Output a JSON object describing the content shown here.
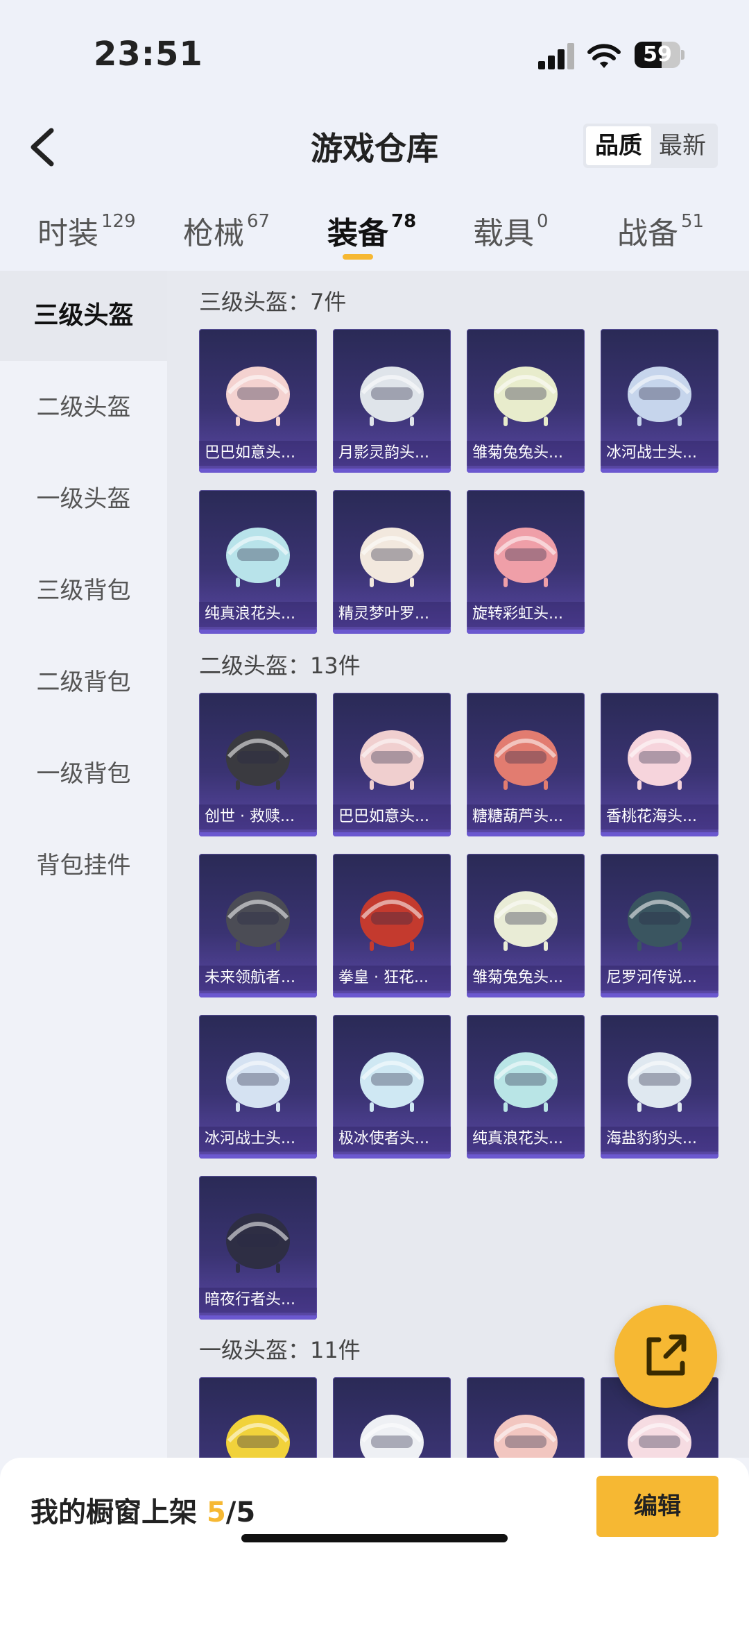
{
  "status": {
    "time": "23:51",
    "battery": "59",
    "battery_level": 0.59
  },
  "header": {
    "title": "游戏仓库",
    "sort_options": [
      "品质",
      "最新"
    ]
  },
  "tabs": [
    {
      "label": "时装",
      "count": "129"
    },
    {
      "label": "枪械",
      "count": "67"
    },
    {
      "label": "装备",
      "count": "78"
    },
    {
      "label": "载具",
      "count": "0"
    },
    {
      "label": "战备",
      "count": "51"
    }
  ],
  "sidebar": {
    "items": [
      "三级头盔",
      "二级头盔",
      "一级头盔",
      "三级背包",
      "二级背包",
      "一级背包",
      "背包挂件"
    ]
  },
  "sections": [
    {
      "title": "三级头盔：7件",
      "items": [
        {
          "name": "巴巴如意头...",
          "color": "#f4d2d0"
        },
        {
          "name": "月影灵韵头...",
          "color": "#dfe4ea"
        },
        {
          "name": "雏菊兔兔头...",
          "color": "#e8eccc"
        },
        {
          "name": "冰河战士头...",
          "color": "#c6d5ec"
        },
        {
          "name": "纯真浪花头...",
          "color": "#b8e3ea"
        },
        {
          "name": "精灵梦叶罗...",
          "color": "#f2e8de"
        },
        {
          "name": "旋转彩虹头...",
          "color": "#ef9fa8"
        }
      ]
    },
    {
      "title": "二级头盔：13件",
      "items": [
        {
          "name": "创世 · 救赎...",
          "color": "#3a3a40"
        },
        {
          "name": "巴巴如意头...",
          "color": "#f0cfcf"
        },
        {
          "name": "糖糖葫芦头...",
          "color": "#e27c70"
        },
        {
          "name": "香桃花海头...",
          "color": "#f6d4dc"
        },
        {
          "name": "未来领航者...",
          "color": "#4b4c55"
        },
        {
          "name": "拳皇 · 狂花...",
          "color": "#c43a2e"
        },
        {
          "name": "雏菊兔兔头...",
          "color": "#e9ecd6"
        },
        {
          "name": "尼罗河传说...",
          "color": "#3a5560"
        },
        {
          "name": "冰河战士头...",
          "color": "#d5e2f2"
        },
        {
          "name": "极冰使者头...",
          "color": "#cfe8f3"
        },
        {
          "name": "纯真浪花头...",
          "color": "#b9e5e6"
        },
        {
          "name": "海盐豹豹头...",
          "color": "#dfe8f0"
        },
        {
          "name": "暗夜行者头...",
          "color": "#2e2e44"
        }
      ]
    },
    {
      "title": "一级头盔：11件",
      "items": [
        {
          "name": "",
          "color": "#f1d23b"
        },
        {
          "name": "",
          "color": "#eef0f4"
        },
        {
          "name": "",
          "color": "#f2c6c0"
        },
        {
          "name": "",
          "color": "#f6dce2"
        }
      ]
    }
  ],
  "bottom": {
    "label": "我的橱窗上架",
    "count": "5",
    "total": "/5",
    "edit_label": "编辑"
  },
  "colors": {
    "accent": "#f6b833"
  }
}
